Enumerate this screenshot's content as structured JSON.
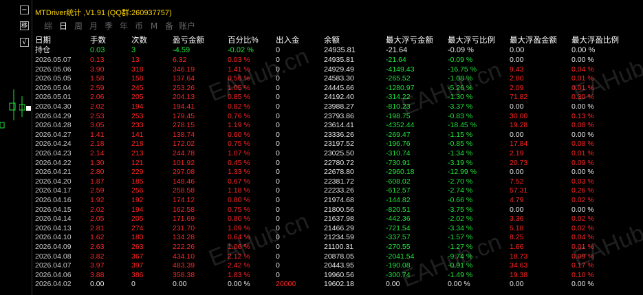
{
  "window": {
    "title": "MTDriver统计 ,V1.91 (QQ群:260937757)"
  },
  "side_tools": {
    "minimize_icon": "−",
    "settings_icon": "移",
    "check_icon": "√"
  },
  "tabs": [
    {
      "label": "综",
      "active": false
    },
    {
      "label": "日",
      "active": true
    },
    {
      "label": "周",
      "active": false
    },
    {
      "label": "月",
      "active": false
    },
    {
      "label": "季",
      "active": false
    },
    {
      "label": "年",
      "active": false
    },
    {
      "label": "币",
      "active": false
    },
    {
      "label": "M",
      "active": false
    },
    {
      "label": "备",
      "active": false
    },
    {
      "label": "账户",
      "active": false
    }
  ],
  "table": {
    "headers": [
      "日期",
      "手数",
      "次数",
      "盈亏金额",
      "百分比%",
      "出入金",
      "余额",
      "最大浮亏金额",
      "最大浮亏比例",
      "最大浮盈金额",
      "最大浮盈比例"
    ],
    "holding": [
      "持仓",
      "0.03",
      "3",
      "-4.59",
      "-0.02 %",
      "0",
      "24935.81",
      "-21.64",
      "-0.09 %",
      "0.00",
      "0.00 %"
    ],
    "rows": [
      [
        "2026.05.07",
        "0.13",
        "13",
        "6.32",
        "0.03 %",
        "0",
        "24935.81",
        "-21.64",
        "-0.09 %",
        "0.00",
        "0.00 %"
      ],
      [
        "2026.05.06",
        "3.90",
        "318",
        "346.19",
        "1.41 %",
        "0",
        "24929.49",
        "-4149.43",
        "-16.75 %",
        "9.43",
        "0.04 %"
      ],
      [
        "2026.05.05",
        "1.58",
        "158",
        "137.64",
        "0.56 %",
        "0",
        "24583.30",
        "-265.52",
        "-1.08 %",
        "2.80",
        "0.01 %"
      ],
      [
        "2026.05.04",
        "2.59",
        "245",
        "253.26",
        "1.05 %",
        "0",
        "24445.66",
        "-1280.97",
        "-5.26 %",
        "2.09",
        "0.01 %"
      ],
      [
        "2026.05.01",
        "2.06",
        "205",
        "204.13",
        "0.85 %",
        "0",
        "24192.40",
        "-314.22",
        "-1.30 %",
        "71.82",
        "0.30 %"
      ],
      [
        "2026.04.30",
        "2.02",
        "194",
        "194.41",
        "0.82 %",
        "0",
        "23988.27",
        "-810.23",
        "-3.37 %",
        "0.00",
        "0.00 %"
      ],
      [
        "2026.04.29",
        "2.53",
        "253",
        "179.45",
        "0.76 %",
        "0",
        "23793.86",
        "-198.75",
        "-0.83 %",
        "30.00",
        "0.13 %"
      ],
      [
        "2026.04.28",
        "3.05",
        "233",
        "278.15",
        "1.19 %",
        "0",
        "23614.41",
        "-4352.44",
        "-18.45 %",
        "19.28",
        "0.08 %"
      ],
      [
        "2026.04.27",
        "1.41",
        "141",
        "138.74",
        "0.60 %",
        "0",
        "23336.26",
        "-269.47",
        "-1.15 %",
        "0.00",
        "0.00 %"
      ],
      [
        "2026.04.24",
        "2.18",
        "218",
        "172.02",
        "0.75 %",
        "0",
        "23197.52",
        "-196.76",
        "-0.85 %",
        "17.84",
        "0.08 %"
      ],
      [
        "2026.04.23",
        "2.14",
        "213",
        "244.78",
        "1.07 %",
        "0",
        "23025.50",
        "-310.74",
        "-1.34 %",
        "2.19",
        "0.01 %"
      ],
      [
        "2026.04.22",
        "1.30",
        "121",
        "101.92",
        "0.45 %",
        "0",
        "22780.72",
        "-730.91",
        "-3.19 %",
        "20.73",
        "0.09 %"
      ],
      [
        "2026.04.21",
        "2.80",
        "229",
        "297.08",
        "1.33 %",
        "0",
        "22678.80",
        "-2960.18",
        "-12.99 %",
        "0.00",
        "0.00 %"
      ],
      [
        "2026.04.20",
        "1.87",
        "185",
        "148.46",
        "0.67 %",
        "0",
        "22381.72",
        "-608.02",
        "-2.70 %",
        "7.52",
        "0.03 %"
      ],
      [
        "2026.04.17",
        "2.59",
        "256",
        "258.58",
        "1.18 %",
        "0",
        "22233.26",
        "-612.57",
        "-2.74 %",
        "57.31",
        "0.26 %"
      ],
      [
        "2026.04.16",
        "1.92",
        "192",
        "174.12",
        "0.80 %",
        "0",
        "21974.68",
        "-144.82",
        "-0.66 %",
        "4.79",
        "0.02 %"
      ],
      [
        "2026.04.15",
        "2.02",
        "194",
        "162.58",
        "0.75 %",
        "0",
        "21800.56",
        "-820.51",
        "-3.75 %",
        "0.00",
        "0.00 %"
      ],
      [
        "2026.04.14",
        "2.05",
        "205",
        "171.69",
        "0.80 %",
        "0",
        "21637.98",
        "-442.36",
        "-2.02 %",
        "3.36",
        "0.02 %"
      ],
      [
        "2026.04.13",
        "2.81",
        "274",
        "231.70",
        "1.09 %",
        "0",
        "21466.29",
        "-721.54",
        "-3.34 %",
        "5.18",
        "0.02 %"
      ],
      [
        "2026.04.10",
        "1.62",
        "180",
        "134.28",
        "0.64 %",
        "0",
        "21234.59",
        "-337.57",
        "-1.57 %",
        "8.25",
        "0.04 %"
      ],
      [
        "2026.04.09",
        "2.63",
        "263",
        "222.26",
        "1.06 %",
        "0",
        "21100.31",
        "-270.55",
        "-1.27 %",
        "1.66",
        "0.01 %"
      ],
      [
        "2026.04.08",
        "3.82",
        "367",
        "434.10",
        "2.12 %",
        "0",
        "20878.05",
        "-2041.54",
        "-9.74 %",
        "18.73",
        "0.09 %"
      ],
      [
        "2026.04.07",
        "3.97",
        "397",
        "483.39",
        "2.42 %",
        "0",
        "20443.95",
        "-190.08",
        "-0.91 %",
        "34.63",
        "0.17 %"
      ],
      [
        "2026.04.06",
        "3.88",
        "386",
        "358.38",
        "1.83 %",
        "0",
        "19960.56",
        "-300.74",
        "-1.49 %",
        "19.38",
        "0.10 %"
      ],
      [
        "2026.04.02",
        "0.00",
        "0",
        "0.00",
        "0.00 %",
        "20000",
        "19602.18",
        "0.00",
        "0.00 %",
        "0.00",
        "0.00 %"
      ]
    ]
  },
  "watermark": "EAHub.cn",
  "colors": {
    "positive": "#ff2424",
    "negative": "#1ee83a",
    "neutral": "#e8e8e8",
    "title": "#ffd700"
  }
}
